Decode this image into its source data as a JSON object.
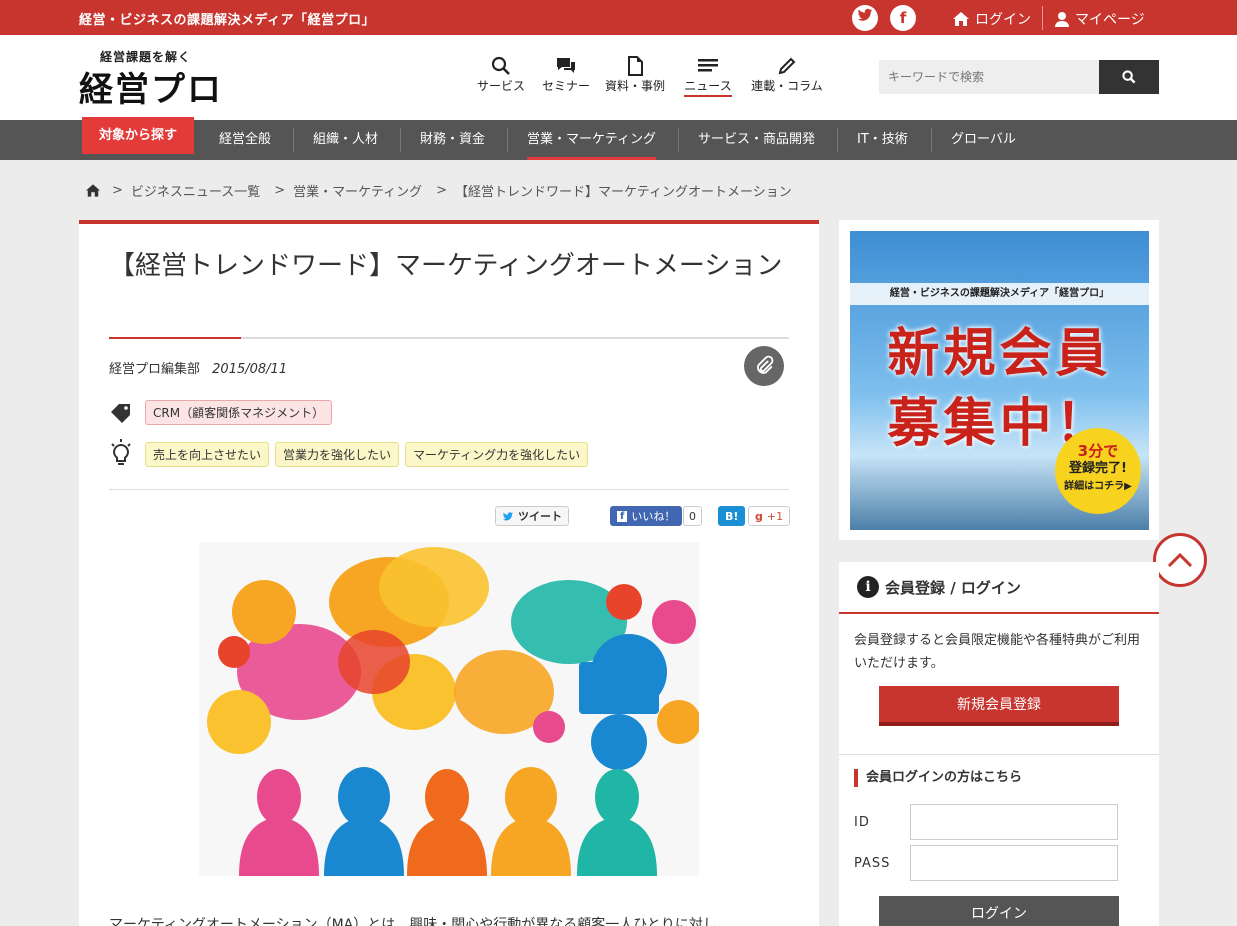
{
  "topbar": {
    "tagline": "経営・ビジネスの課題解決メディア「経営プロ」",
    "twitter_icon": "twitter-icon",
    "facebook_icon": "facebook-icon",
    "login": "ログイン",
    "mypage": "マイページ"
  },
  "logo": {
    "sub": "経営課題を解く",
    "main": "経営プロ"
  },
  "gnav": [
    {
      "label": "サービス",
      "icon": "search-icon"
    },
    {
      "label": "セミナー",
      "icon": "chat-icon"
    },
    {
      "label": "資料・事例",
      "icon": "document-icon"
    },
    {
      "label": "ニュース",
      "icon": "news-icon"
    },
    {
      "label": "連載・コラム",
      "icon": "pencil-icon"
    }
  ],
  "search": {
    "placeholder": "キーワードで検索"
  },
  "catbar": {
    "button": "対象から探す",
    "items": [
      "経営全般",
      "組織・人材",
      "財務・資金",
      "営業・マーケティング",
      "サービス・商品開発",
      "IT・技術",
      "グローバル"
    ],
    "active": "営業・マーケティング"
  },
  "breadcrumb": [
    "ビジネスニュース一覧",
    "営業・マーケティング",
    "【経営トレンドワード】マーケティングオートメーション"
  ],
  "article": {
    "title": "【経営トレンドワード】マーケティングオートメーション",
    "author": "経営プロ編集部",
    "date": "2015/08/11",
    "category_tags": [
      "CRM（顧客関係マネジメント）"
    ],
    "purpose_tags": [
      "売上を向上させたい",
      "営業力を強化したい",
      "マーケティング力を強化したい"
    ],
    "social": {
      "tweet": "ツイート",
      "like": "いいね！",
      "like_count": "0",
      "hatena": "B!",
      "gplus": "+1"
    },
    "lead": "マーケティングオートメーション（MA）とは、興味・関心や行動が異なる顧客一人ひとりに対し"
  },
  "ad": {
    "strip": "経営・ビジネスの課題解決メディア「経営プロ」",
    "line1": "新規会員",
    "line2": "募集中！",
    "circle1": "3分で",
    "circle2": "登録完了!",
    "circle3": "詳細はコチラ▶"
  },
  "login_box": {
    "title": "会員登録 / ログイン",
    "description": "会員登録すると会員限定機能や各種特典がご利用いただけます。",
    "register": "新規会員登録",
    "subheading": "会員ログインの方はこちら",
    "id_label": "ID",
    "pass_label": "PASS",
    "login_button": "ログイン"
  },
  "colors": {
    "brand_red": "#c8352f",
    "catbar": "#555555",
    "tag_red_bg": "#fce4e4",
    "tag_yellow_bg": "#fbf7c8"
  }
}
